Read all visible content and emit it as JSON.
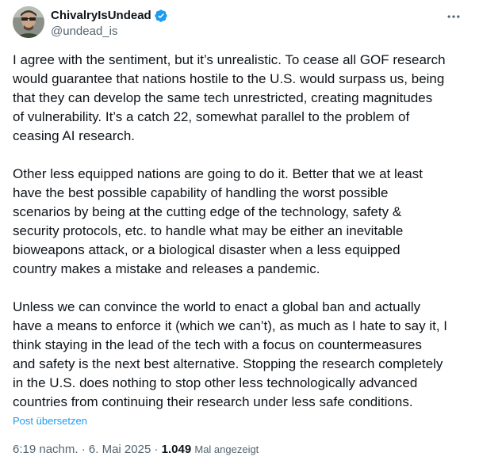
{
  "author": {
    "display_name": "ChivalryIsUndead",
    "handle": "@undead_is",
    "avatar_icon": "user-avatar",
    "verified_icon": "verified-badge-icon",
    "verified_color": "#1d9bf0"
  },
  "menu": {
    "more_icon": "more-horizontal-icon"
  },
  "tweet": {
    "paragraph_1": "I agree with the sentiment, but it’s unrealistic. To cease all GOF research\nwould guarantee that nations hostile to the U.S. would surpass us, being\nthat they can develop the same tech unrestricted, creating magnitudes\nof vulnerability. It’s a catch 22, somewhat parallel to the problem of\nceasing AI research.",
    "paragraph_2": "Other less equipped nations are going to do it. Better that we at least\nhave the best possible capability of handling the worst possible\nscenarios by being at the cutting edge of the technology, safety &\nsecurity protocols, etc. to handle what may be either an inevitable\nbioweapons attack, or a biological disaster when a less equipped\ncountry makes a mistake and releases a pandemic.",
    "paragraph_3": "Unless we can convince the world to enact a global ban and actually\nhave a means to enforce it (which we can’t), as much as I hate to say it, I\nthink staying in the lead of the tech with a focus on countermeasures\nand safety is the next best alternative. Stopping the research completely\nin the U.S. does nothing to stop other less technologically advanced\ncountries from continuing their research under less safe conditions.",
    "translate_label": "Post übersetzen"
  },
  "meta": {
    "time": "6:19 nachm.",
    "separator": " · ",
    "date": "6. Mai 2025",
    "views_count": "1.049",
    "views_label": "Mal angezeigt"
  },
  "colors": {
    "text_primary": "#0f1419",
    "text_secondary": "#536471",
    "link": "#1d9bf0"
  }
}
